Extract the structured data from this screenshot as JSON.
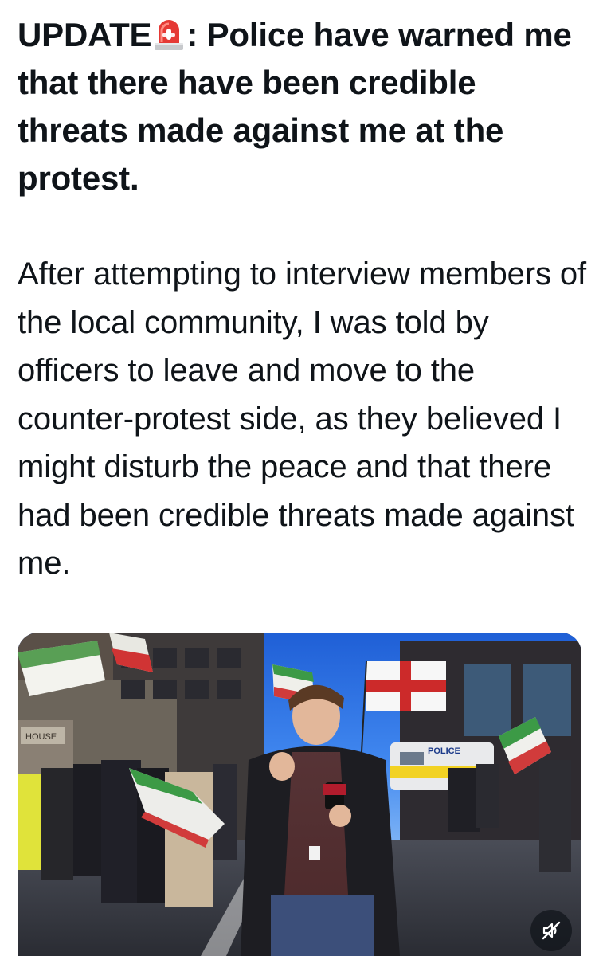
{
  "tweet": {
    "headline_prefix": "UPDATE",
    "headline_emoji": "siren-emoji",
    "headline_text": ": Police have warned me that there have been credible threats made against me at the protest.",
    "paragraph": "After attempting to interview members of the local community, I was told by officers to leave and move to the counter-protest side, as they believed I might disturb the peace and that there had been credible threats made against me."
  },
  "media": {
    "type": "video",
    "van_text": "POLICE",
    "shop_sign": "HOUSE",
    "mute_icon": "muted-speaker-icon"
  },
  "colors": {
    "text": "#0f1419",
    "background": "#ffffff",
    "mute_button_bg": "#0f1419"
  }
}
